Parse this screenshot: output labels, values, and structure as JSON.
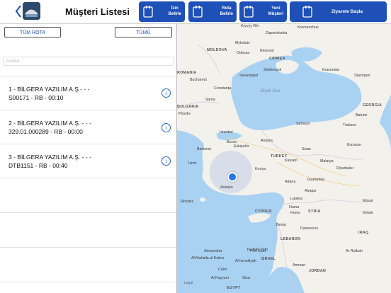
{
  "header": {
    "title": "Müşteri Listesi",
    "buttons": [
      {
        "label": "İzin\nBelirle",
        "name": "izin-belirle"
      },
      {
        "label": "Rota\nBelirle",
        "name": "rota-belirle"
      },
      {
        "label": "Yeni\nMüşteri",
        "name": "yeni-musteri"
      },
      {
        "label": "Ziyarete Başla",
        "name": "ziyarete-basla"
      }
    ]
  },
  "left": {
    "route_all_label": "TÜM ROTA",
    "all_label": "TÜMÜ",
    "search_placeholder": "Arama",
    "customers": [
      {
        "line1": "1 - BİLGERA YAZILIM A.Ş  -  -  -",
        "line2": "S00171 -  RB - 00:10"
      },
      {
        "line1": "2 - BİLGERA YAZILIM A.Ş.  -  -  -",
        "line2": "329.01.000289 -  RB - 00:00"
      },
      {
        "line1": "3 - BİLGERA YAZILIM A.Ş.  -  -  -",
        "line2": "DTB1151 -  RB - 00:40"
      }
    ]
  },
  "map": {
    "legal": "Legal",
    "labels": {
      "krivyy_rih": "Kryvyy Rih",
      "kremenchuk": "Kremenchuk",
      "zaporizhzhia": "Zaporizhzhia",
      "mykolaiv": "Mykolaiv",
      "odessa": "Odessa",
      "kherson": "Kherson",
      "crimea": "CRIMEA",
      "krasnodar": "Krasnodar",
      "stavropol": "Stavropol",
      "moldova": "MOLDOVA",
      "bucharest": "Bucharest",
      "sevastopol": "Sevastopol",
      "simferopol": "Simferopol",
      "romania": "ROMANIA",
      "constanta": "Constanța",
      "varna": "Varna",
      "black_sea": "Black Sea",
      "bulgaria": "BULGARIA",
      "plovdiv": "Plovdiv",
      "georgia": "GEORGIA",
      "batumi": "Batumi",
      "samsun": "Samsun",
      "trabzon": "Trabzon",
      "istanbul": "İstanbul",
      "bursa": "Bursa",
      "ankara": "Ankara",
      "eskisehir": "Eskişehir",
      "sivas": "Sivas",
      "izmir": "İzmir",
      "balikesir": "Balıkesir",
      "turkey": "TURKEY",
      "erzurum": "Erzurum",
      "kayseri": "Kayseri",
      "malatya": "Malatya",
      "konya": "Konya",
      "diyarbakir": "Diyarbakır",
      "antalya": "Antalya",
      "adana": "Adana",
      "gaziantep": "Gaziantep",
      "aleppo": "Aleppo",
      "rhodes": "Rhodes",
      "cyprus": "CYPRUS",
      "latakia": "Latakia",
      "syria": "SYRIA",
      "hama": "Hama",
      "homs": "Homs",
      "mosul": "Mosul",
      "kirkuk": "Kirkuk",
      "beirut": "Beirut",
      "lebanon": "LEBANON",
      "damascus": "Damascus",
      "iraq": "IRAQ",
      "tel_aviv": "Tel Aviv-Yafo",
      "amman": "Amman",
      "alexandria": "Alexandria",
      "port_said": "Port Said",
      "israel": "ISRAEL",
      "al_mahalla": "Al Mahalla al Kubra",
      "al_ismailiyah": "Al Ismailiyah",
      "cairo": "Cairo",
      "al_fayyum": "Al Fayyum",
      "giza": "Giza",
      "jordan": "JORDAN",
      "egypt": "EGYPT",
      "ar_rutbah": "Ar Rutbah"
    }
  },
  "colors": {
    "brand_blue": "#1e50b8",
    "land": "#f3f1ec",
    "sea": "#a9d1f2",
    "location_dot": "#1f78f0"
  }
}
